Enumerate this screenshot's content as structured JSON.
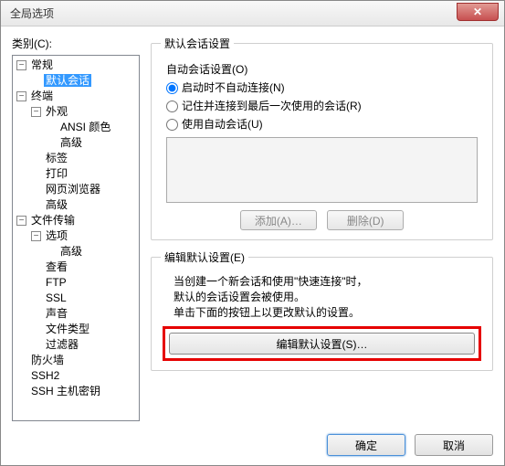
{
  "window": {
    "title": "全局选项"
  },
  "close_label": "✕",
  "category_label": "类别(C):",
  "tree": {
    "n0": "常规",
    "n0_0": "默认会话",
    "n1": "终端",
    "n1_0": "外观",
    "n1_0_0": "ANSI 颜色",
    "n1_0_1": "高级",
    "n1_1": "标签",
    "n1_2": "打印",
    "n1_3": "网页浏览器",
    "n1_4": "高级",
    "n2": "文件传输",
    "n2_0": "选项",
    "n2_0_0": "高级",
    "n2_1": "查看",
    "n2_2": "FTP",
    "n2_3": "SSL",
    "n2_4": "声音",
    "n2_5": "文件类型",
    "n2_6": "过滤器",
    "n3": "防火墙",
    "n4": "SSH2",
    "n5": "SSH 主机密钥"
  },
  "group1": {
    "legend": "默认会话设置",
    "auto_label": "自动会话设置(O)",
    "opt1": "启动时不自动连接(N)",
    "opt2": "记住并连接到最后一次使用的会话(R)",
    "opt3": "使用自动会话(U)",
    "add_btn": "添加(A)…",
    "del_btn": "删除(D)"
  },
  "group2": {
    "legend": "编辑默认设置(E)",
    "line1": "当创建一个新会话和使用\"快速连接\"时，",
    "line2": "默认的会话设置会被使用。",
    "line3": "单击下面的按钮上以更改默认的设置。",
    "edit_btn": "编辑默认设置(S)…"
  },
  "footer": {
    "ok": "确定",
    "cancel": "取消"
  }
}
